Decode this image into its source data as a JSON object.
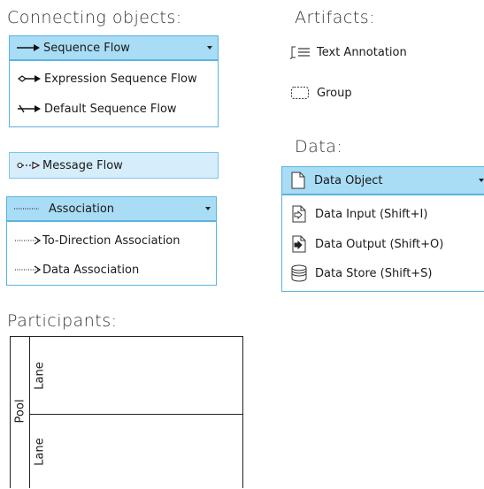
{
  "headings": {
    "connecting": "Connecting objects:",
    "artifacts": "Artifacts:",
    "data": "Data:",
    "participants": "Participants:"
  },
  "connecting": {
    "sequence_flow": "Sequence Flow",
    "expression_sequence_flow": "Expression Sequence Flow",
    "default_sequence_flow": "Default Sequence Flow",
    "message_flow": "Message Flow",
    "association": "Association",
    "to_direction_association": "To-Direction Association",
    "data_association": "Data Association"
  },
  "artifacts": {
    "text_annotation": "Text Annotation",
    "group": "Group"
  },
  "data": {
    "data_object": "Data Object",
    "data_input": "Data Input (Shift+I)",
    "data_output": "Data Output (Shift+O)",
    "data_store": "Data Store (Shift+S)"
  },
  "participants": {
    "pool": "Pool",
    "lane_1": "Lane",
    "lane_2": "Lane"
  },
  "colors": {
    "active_fill": "#a9dcf5",
    "active_border": "#5ab3e0",
    "light_fill": "#d6eefb"
  },
  "icons": {
    "sequence_flow": "arrow-right-icon",
    "expression_sequence_flow": "diamond-arrow-icon",
    "default_sequence_flow": "slash-arrow-icon",
    "message_flow": "dashed-message-arrow-icon",
    "association": "dotted-line-icon",
    "to_direction_association": "dotted-arrow-icon",
    "data_association": "dotted-arrow-icon",
    "text_annotation": "text-annotation-icon",
    "group": "group-icon",
    "data_object": "document-icon",
    "data_input": "document-input-icon",
    "data_output": "document-output-icon",
    "data_store": "database-icon"
  }
}
